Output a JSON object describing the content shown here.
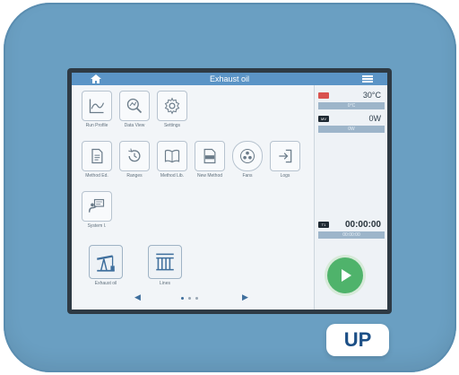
{
  "header": {
    "title": "Exhaust oil"
  },
  "tiles": [
    {
      "label": "Run Profile",
      "icon": "chart-icon"
    },
    {
      "label": "Data View",
      "icon": "magnify-icon"
    },
    {
      "label": "Settings",
      "icon": "gear-icon"
    },
    {
      "label": "Method Ed.",
      "icon": "document-icon"
    },
    {
      "label": "Ranges",
      "icon": "history-icon"
    },
    {
      "label": "Method Lib.",
      "icon": "book-icon"
    },
    {
      "label": "New Method",
      "icon": "new-file-icon"
    },
    {
      "label": "Fans",
      "icon": "fan-icon"
    },
    {
      "label": "Logs",
      "icon": "login-icon"
    },
    {
      "label": "System I.",
      "icon": "presenter-icon"
    }
  ],
  "favorites": [
    {
      "label": "Exhaust oil",
      "icon": "pumpjack-icon"
    },
    {
      "label": "Lines",
      "icon": "sieve-icon"
    }
  ],
  "status": {
    "temperature": "30°C",
    "temperature_sub": "0°C",
    "power_tag": "MV",
    "power": "0W",
    "power_sub": "0W",
    "timer_tag": "T1",
    "timer": "00:00:00",
    "timer_sub": "00:00:00"
  },
  "pager": {
    "page": 1,
    "pages": 3
  },
  "brand": {
    "label": "UP"
  },
  "colors": {
    "accent": "#5b94c6",
    "play": "#4fb36b",
    "temp_tag": "#d9534f",
    "tag": "#1f2a33"
  }
}
